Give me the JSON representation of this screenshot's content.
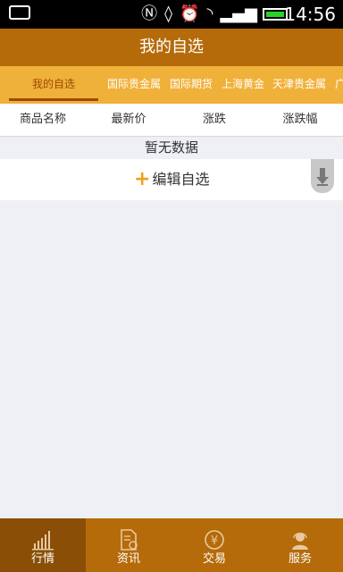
{
  "status": {
    "time": "14:56"
  },
  "header": {
    "title": "我的自选"
  },
  "tabs": [
    {
      "label": "我的自选"
    },
    {
      "label": "国际贵金属"
    },
    {
      "label": "国际期货"
    },
    {
      "label": "上海黄金"
    },
    {
      "label": "天津贵金属"
    },
    {
      "label": "广"
    }
  ],
  "columns": [
    "商品名称",
    "最新价",
    "涨跌",
    "涨跌幅"
  ],
  "content": {
    "empty_text": "暂无数据",
    "edit_label": "编辑自选"
  },
  "nav": [
    {
      "label": "行情"
    },
    {
      "label": "资讯"
    },
    {
      "label": "交易"
    },
    {
      "label": "服务"
    }
  ],
  "colors": {
    "primary": "#b56b0a",
    "tabs": "#f0b13a",
    "active_nav": "#8a4e06"
  }
}
